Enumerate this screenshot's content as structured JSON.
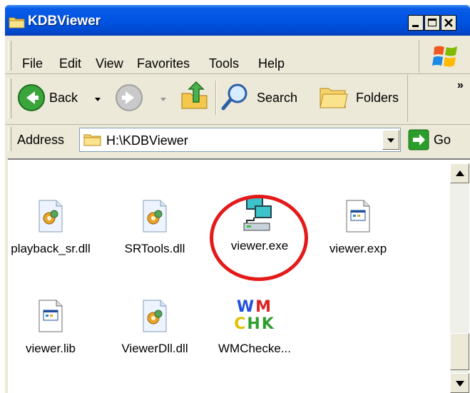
{
  "window": {
    "title": "KDBViewer"
  },
  "title_buttons": [
    "_",
    "□",
    "X"
  ],
  "menu": [
    "File",
    "Edit",
    "View",
    "Favorites",
    "Tools",
    "Help"
  ],
  "toolbar": {
    "back_label": "Back",
    "search_label": "Search",
    "folders_label": "Folders",
    "overflow": "»"
  },
  "address": {
    "label": "Address",
    "value": "H:\\KDBViewer",
    "go_label": "Go"
  },
  "files": [
    {
      "name": "playback_sr.dll",
      "icon": "dll-file-icon"
    },
    {
      "name": "SRTools.dll",
      "icon": "dll-file-icon"
    },
    {
      "name": "viewer.exe",
      "icon": "application-exe-icon",
      "highlighted": true
    },
    {
      "name": "viewer.exp",
      "icon": "generic-file-icon"
    },
    {
      "name": "viewer.lib",
      "icon": "generic-file-icon"
    },
    {
      "name": "ViewerDll.dll",
      "icon": "dll-file-icon"
    },
    {
      "name": "WMChecke...",
      "icon": "wmchk-app-icon",
      "icon_text": [
        "WM",
        "CHK"
      ]
    }
  ],
  "colors": {
    "title_blue": "#0054e3",
    "highlight_red": "#e41a1a",
    "go_green": "#2a9d2a"
  }
}
